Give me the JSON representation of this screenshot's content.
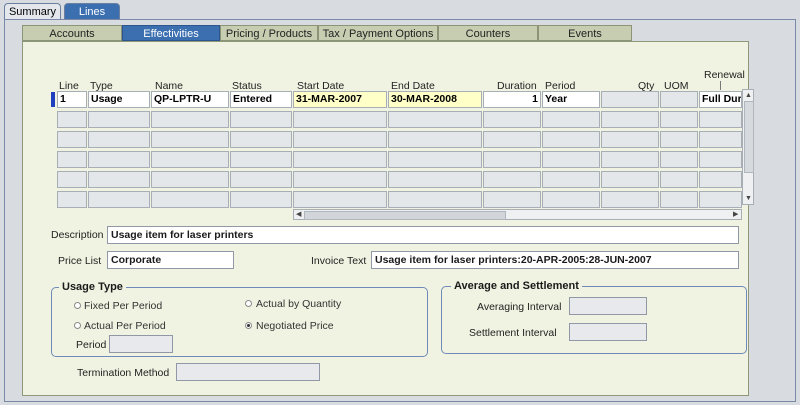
{
  "top_tabs": [
    {
      "label": "Summary"
    },
    {
      "label": "Lines"
    }
  ],
  "sub_tabs": [
    {
      "label": "Accounts"
    },
    {
      "label": "Effectivities"
    },
    {
      "label": "Pricing / Products"
    },
    {
      "label": "Tax / Payment Options"
    },
    {
      "label": "Counters"
    },
    {
      "label": "Events"
    }
  ],
  "table": {
    "headers": {
      "line": "Line",
      "type": "Type",
      "name": "Name",
      "status": "Status",
      "start_date": "Start Date",
      "end_date": "End Date",
      "duration": "Duration",
      "period": "Period",
      "qty": "Qty",
      "uom": "UOM",
      "renewal": "Renewal"
    },
    "row1": {
      "line": "1",
      "type": "Usage",
      "name": "QP-LPTR-U",
      "status": "Entered",
      "start_date": "31-MAR-2007",
      "end_date": "30-MAR-2008",
      "duration": "1",
      "period": "Year",
      "qty": "",
      "uom": "",
      "renewal": "Full Dur"
    }
  },
  "description": {
    "label": "Description",
    "value": "Usage item for laser printers"
  },
  "price_list": {
    "label": "Price List",
    "value": "Corporate"
  },
  "invoice_text": {
    "label": "Invoice Text",
    "value": "Usage item for laser printers:20-APR-2005:28-JUN-2007"
  },
  "usage_type": {
    "title": "Usage Type",
    "options": [
      {
        "label": "Fixed Per Period",
        "selected": false
      },
      {
        "label": "Actual by Quantity",
        "selected": false
      },
      {
        "label": "Actual Per Period",
        "selected": false
      },
      {
        "label": "Negotiated Price",
        "selected": true
      }
    ],
    "period_label": "Period",
    "period_value": ""
  },
  "avg_settlement": {
    "title": "Average and Settlement",
    "averaging_label": "Averaging Interval",
    "averaging_value": "",
    "settlement_label": "Settlement Interval",
    "settlement_value": ""
  },
  "termination": {
    "label": "Termination Method",
    "value": ""
  }
}
